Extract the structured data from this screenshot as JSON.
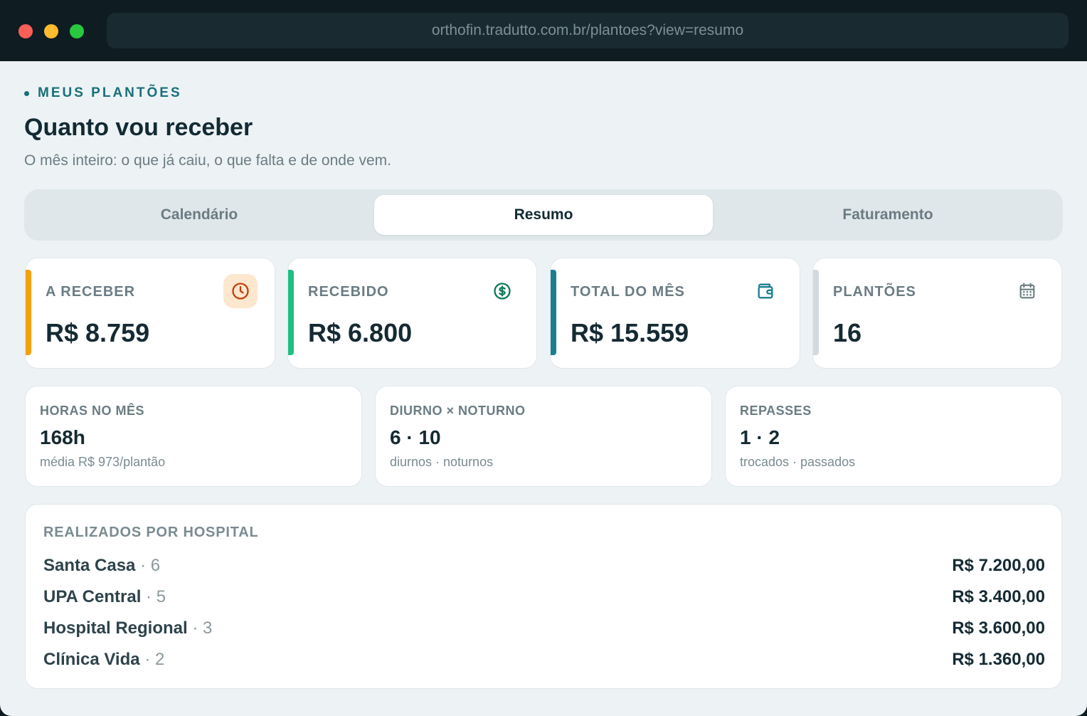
{
  "browser": {
    "url": "orthofin.tradutto.com.br/plantoes?view=resumo"
  },
  "header": {
    "eyebrow": "MEUS PLANTÕES",
    "title": "Quanto vou receber",
    "subtitle": "O mês inteiro: o que já caiu, o que falta e de onde vem."
  },
  "tabs": [
    {
      "label": "Calendário",
      "active": false
    },
    {
      "label": "Resumo",
      "active": true
    },
    {
      "label": "Faturamento",
      "active": false
    }
  ],
  "kpis": [
    {
      "label": "A RECEBER",
      "value": "R$ 8.759",
      "icon": "clock-icon",
      "accent": "#f2a20c"
    },
    {
      "label": "RECEBIDO",
      "value": "R$ 6.800",
      "icon": "dollar-circle-icon",
      "accent": "#1fbf83"
    },
    {
      "label": "TOTAL DO MÊS",
      "value": "R$ 15.559",
      "icon": "wallet-icon",
      "accent": "#1a7f8f"
    },
    {
      "label": "PLANTÕES",
      "value": "16",
      "icon": "calendar-icon",
      "accent": "#d3dadd"
    }
  ],
  "stats": [
    {
      "label": "HORAS NO MÊS",
      "value": "168h",
      "sub": "média R$ 973/plantão"
    },
    {
      "label": "DIURNO × NOTURNO",
      "value": "6 · 10",
      "sub": "diurnos · noturnos"
    },
    {
      "label": "REPASSES",
      "value": "1 · 2",
      "sub": "trocados · passados"
    }
  ],
  "hospitals": {
    "label": "REALIZADOS POR HOSPITAL",
    "rows": [
      {
        "name": "Santa Casa",
        "count": " · 6",
        "amount": "R$ 7.200,00"
      },
      {
        "name": "UPA Central",
        "count": " · 5",
        "amount": "R$ 3.400,00"
      },
      {
        "name": "Hospital Regional",
        "count": " · 3",
        "amount": "R$ 3.600,00"
      },
      {
        "name": "Clínica Vida",
        "count": " · 2",
        "amount": "R$ 1.360,00"
      }
    ]
  }
}
